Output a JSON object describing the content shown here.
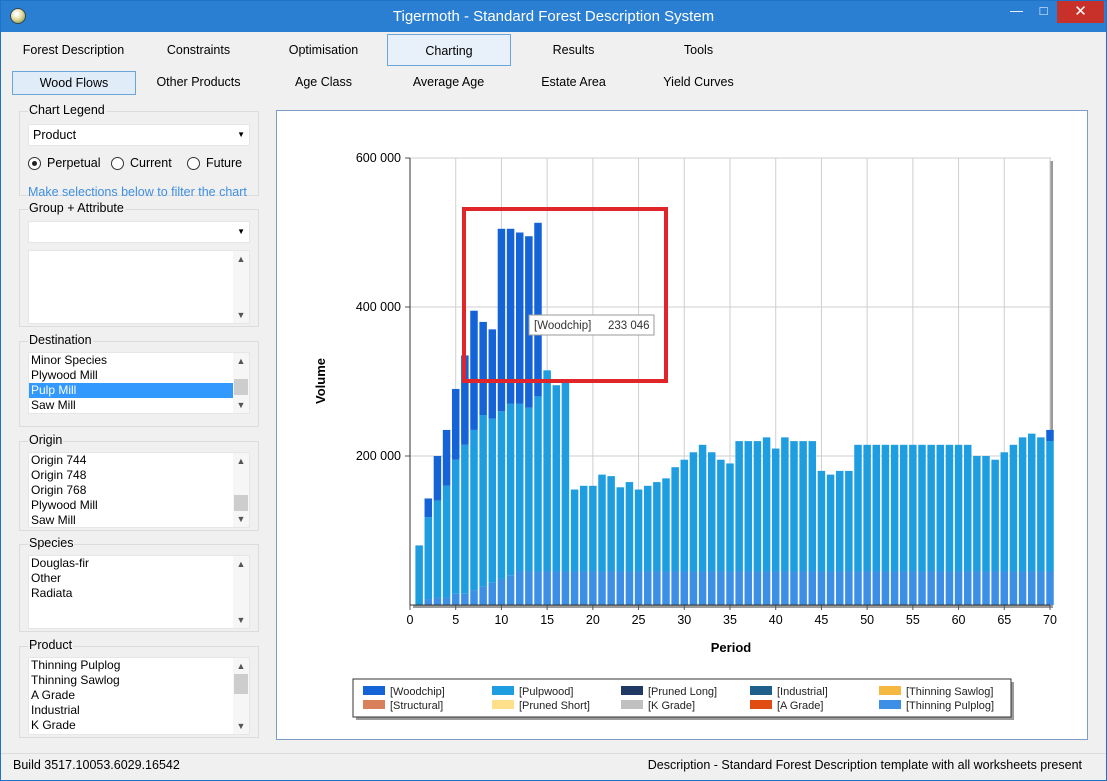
{
  "window": {
    "title": "Tigermoth - Standard Forest Description System",
    "minimize": "—",
    "maximize": "□",
    "close": "✕"
  },
  "main_tabs": [
    "Forest Description",
    "Constraints",
    "Optimisation",
    "Charting",
    "Results",
    "Tools"
  ],
  "sub_tabs": [
    "Wood Flows",
    "Other Products",
    "Age Class",
    "Average Age",
    "Estate Area",
    "Yield Curves"
  ],
  "sidebar": {
    "chart_legend": {
      "label": "Chart Legend",
      "value": "Product",
      "radios": [
        "Perpetual",
        "Current",
        "Future"
      ],
      "selected": "Perpetual"
    },
    "hint": "Make selections below to filter the chart",
    "group_attribute": {
      "label": "Group + Attribute",
      "value": ""
    },
    "destination": {
      "label": "Destination",
      "items": [
        "Minor Species",
        "Plywood Mill",
        "Pulp Mill",
        "Saw Mill"
      ],
      "selected": "Pulp Mill"
    },
    "origin": {
      "label": "Origin",
      "items": [
        "Origin 744",
        "Origin 748",
        "Origin 768",
        "Plywood Mill",
        "Saw Mill"
      ]
    },
    "species": {
      "label": "Species",
      "items": [
        "Douglas-fir",
        "Other",
        "Radiata"
      ]
    },
    "product": {
      "label": "Product",
      "items": [
        "Thinning Pulplog",
        "Thinning Sawlog",
        "A Grade",
        "Industrial",
        "K Grade"
      ]
    }
  },
  "chart_data": {
    "type": "bar",
    "stacked": true,
    "xlabel": "Period",
    "ylabel": "Volume",
    "xlim": [
      0,
      70
    ],
    "ylim": [
      0,
      600000
    ],
    "x_ticks": [
      "0",
      "5",
      "10",
      "15",
      "20",
      "25",
      "30",
      "35",
      "40",
      "45",
      "50",
      "55",
      "60",
      "65",
      "70"
    ],
    "y_ticks": [
      "600 000",
      "400 000",
      "200 000"
    ],
    "grid": true,
    "legend_position": "bottom",
    "tooltip": {
      "series": "[Woodchip]",
      "value": "233 046"
    },
    "colors": {
      "woodchip": "#1464d8",
      "pulpwood": "#1e9ee0",
      "thinning_pulplog": "#3d8fe6"
    },
    "periods": [
      1,
      2,
      3,
      4,
      5,
      6,
      7,
      8,
      9,
      10,
      11,
      12,
      13,
      14,
      15,
      16,
      17,
      18,
      19,
      20,
      21,
      22,
      23,
      24,
      25,
      26,
      27,
      28,
      29,
      30,
      31,
      32,
      33,
      34,
      35,
      36,
      37,
      38,
      39,
      40,
      41,
      42,
      43,
      44,
      45,
      46,
      47,
      48,
      49,
      50,
      51,
      52,
      53,
      54,
      55,
      56,
      57,
      58,
      59,
      60,
      61,
      62,
      63,
      64,
      65,
      66,
      67,
      68,
      69,
      70
    ],
    "series": [
      {
        "name": "[Thinning Pulplog]",
        "values": [
          0,
          8000,
          10000,
          10000,
          15000,
          15000,
          20000,
          25000,
          30000,
          35000,
          40000,
          45000,
          45000,
          45000,
          45000,
          45000,
          45000,
          45000,
          45000,
          45000,
          45000,
          45000,
          45000,
          45000,
          45000,
          45000,
          45000,
          45000,
          45000,
          45000,
          45000,
          45000,
          45000,
          45000,
          45000,
          45000,
          45000,
          45000,
          45000,
          45000,
          45000,
          45000,
          45000,
          45000,
          45000,
          45000,
          45000,
          45000,
          45000,
          45000,
          45000,
          45000,
          45000,
          45000,
          45000,
          45000,
          45000,
          45000,
          45000,
          45000,
          45000,
          45000,
          45000,
          45000,
          45000,
          45000,
          45000,
          45000,
          45000,
          45000
        ]
      },
      {
        "name": "[Pulpwood]",
        "values": [
          80000,
          110000,
          130000,
          150000,
          180000,
          200000,
          215000,
          230000,
          220000,
          225000,
          230000,
          225000,
          220000,
          235000,
          270000,
          250000,
          255000,
          110000,
          115000,
          115000,
          130000,
          128000,
          113000,
          120000,
          110000,
          115000,
          120000,
          125000,
          140000,
          150000,
          160000,
          170000,
          160000,
          150000,
          145000,
          175000,
          175000,
          175000,
          180000,
          165000,
          180000,
          175000,
          175000,
          175000,
          135000,
          130000,
          135000,
          135000,
          170000,
          170000,
          170000,
          170000,
          170000,
          170000,
          170000,
          170000,
          170000,
          170000,
          170000,
          170000,
          170000,
          155000,
          155000,
          150000,
          160000,
          170000,
          180000,
          185000,
          180000,
          175000
        ]
      },
      {
        "name": "[Woodchip]",
        "values": [
          0,
          25000,
          60000,
          75000,
          95000,
          120000,
          160000,
          125000,
          120000,
          245000,
          235000,
          230000,
          230000,
          233046,
          0,
          0,
          0,
          0,
          0,
          0,
          0,
          0,
          0,
          0,
          0,
          0,
          0,
          0,
          0,
          0,
          0,
          0,
          0,
          0,
          0,
          0,
          0,
          0,
          0,
          0,
          0,
          0,
          0,
          0,
          0,
          0,
          0,
          0,
          0,
          0,
          0,
          0,
          0,
          0,
          0,
          0,
          0,
          0,
          0,
          0,
          0,
          0,
          0,
          0,
          0,
          0,
          0,
          0,
          0,
          15000
        ]
      }
    ],
    "legend": [
      {
        "label": "[Woodchip]",
        "color": "#1464d8"
      },
      {
        "label": "[Pulpwood]",
        "color": "#1e9ee0"
      },
      {
        "label": "[Pruned Long]",
        "color": "#1f3864"
      },
      {
        "label": "[Industrial]",
        "color": "#1f5f8b"
      },
      {
        "label": "[Thinning Sawlog]",
        "color": "#f5b942"
      },
      {
        "label": "[Structural]",
        "color": "#d9805a"
      },
      {
        "label": "[Pruned Short]",
        "color": "#ffe08a"
      },
      {
        "label": "[K Grade]",
        "color": "#c0c0c0"
      },
      {
        "label": "[A Grade]",
        "color": "#e04c12"
      },
      {
        "label": "[Thinning Pulplog]",
        "color": "#3d8fe6"
      }
    ]
  },
  "status": {
    "build": "Build 3517.10053.6029.16542",
    "description": "Description - Standard Forest Description template with all worksheets present"
  }
}
